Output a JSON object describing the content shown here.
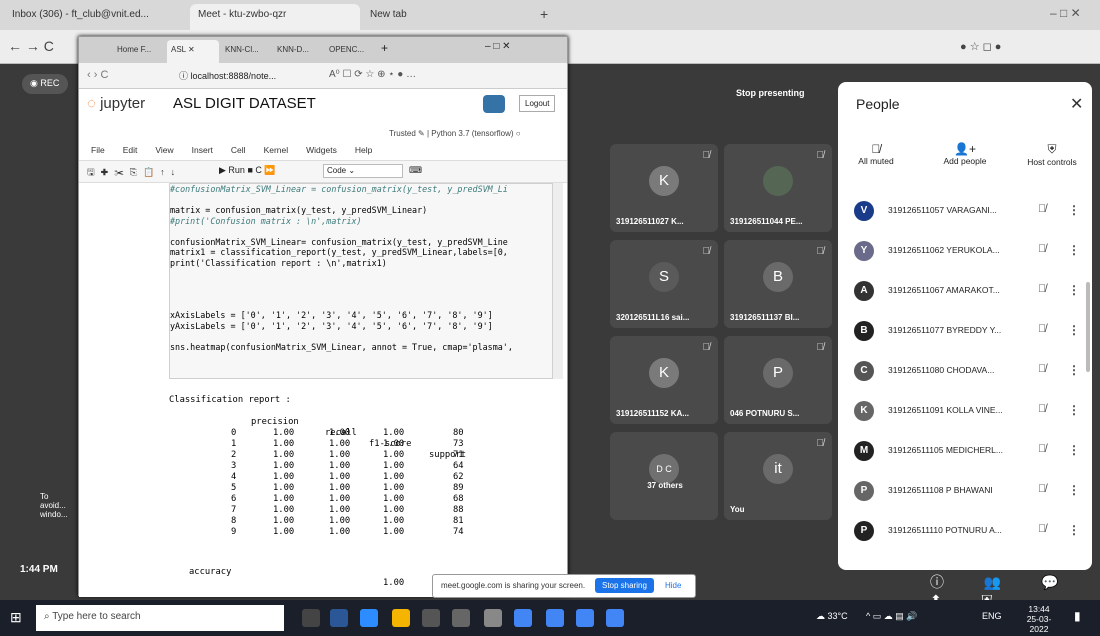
{
  "outer_tabs": [
    {
      "label": "Inbox (306) - ft_club@vnit.ed..."
    },
    {
      "label": "Meet - ktu-zwbo-qzr"
    },
    {
      "label": "New tab"
    }
  ],
  "meet": {
    "rec_label": "REC",
    "stop_presenting": "Stop presenting",
    "clock": "1:44 PM",
    "side_text": "To avoid... windo...",
    "tiles": [
      {
        "initial": "K",
        "name": "319126511027 K...",
        "color": "#7a7a7a"
      },
      {
        "initial": "",
        "name": "319126511044 PE...",
        "color": "#5a6a5a"
      },
      {
        "initial": "S",
        "name": "320126511L16 sai...",
        "color": "#5a5a5a"
      },
      {
        "initial": "B",
        "name": "319126511137 BI...",
        "color": "#6a6a6a"
      },
      {
        "initial": "K",
        "name": "319126511152 KA...",
        "color": "#7a7a7a"
      },
      {
        "initial": "P",
        "name": "046 POTNURU S...",
        "color": "#6a6a6a"
      },
      {
        "initial": "D C",
        "name": "37 others",
        "color": "#707070"
      },
      {
        "initial": "it",
        "name": "You",
        "color": "#6a6a6a"
      }
    ]
  },
  "inner_browser": {
    "tabs": [
      {
        "label": "Home F..."
      },
      {
        "label": "ASL"
      },
      {
        "label": "KNN-Cl..."
      },
      {
        "label": "KNN-D..."
      },
      {
        "label": "OPENC..."
      }
    ],
    "address": "localhost:8888/note...",
    "jupyter_logo": "jupyter",
    "notebook_title": "ASL DIGIT DATASET",
    "logout": "Logout",
    "trusted": "Trusted",
    "kernel": "Python 3.7 (tensorflow)",
    "menu": [
      "File",
      "Edit",
      "View",
      "Insert",
      "Cell",
      "Kernel",
      "Widgets",
      "Help"
    ],
    "run_label": "Run",
    "cell_type": "Code",
    "code_lines": [
      "#confusionMatrix_SVM_Linear = confusion_matrix(y_test, y_predSVM_Li",
      "",
      "matrix = confusion_matrix(y_test, y_predSVM_Linear)",
      "#print('Confusion matrix : \\n',matrix)",
      "",
      "confusionMatrix_SVM_Linear= confusion_matrix(y_test, y_predSVM_Line",
      "matrix1 = classification_report(y_test, y_predSVM_Linear,labels=[0,",
      "print('Classification report : \\n',matrix1)",
      "",
      "",
      "",
      "",
      "xAxisLabels = ['0', '1', '2', '3', '4', '5', '6', '7', '8', '9']",
      "yAxisLabels = ['0', '1', '2', '3', '4', '5', '6', '7', '8', '9']",
      "",
      "sns.heatmap(confusionMatrix_SVM_Linear, annot = True, cmap='plasma',"
    ],
    "report_title": "Classification report :",
    "report_headers": [
      "precision",
      "recall",
      "f1-score",
      "support"
    ],
    "report_rows": [
      {
        "label": "0",
        "precision": "1.00",
        "recall": "1.00",
        "f1": "1.00",
        "support": "80"
      },
      {
        "label": "1",
        "precision": "1.00",
        "recall": "1.00",
        "f1": "1.00",
        "support": "73"
      },
      {
        "label": "2",
        "precision": "1.00",
        "recall": "1.00",
        "f1": "1.00",
        "support": "71"
      },
      {
        "label": "3",
        "precision": "1.00",
        "recall": "1.00",
        "f1": "1.00",
        "support": "64"
      },
      {
        "label": "4",
        "precision": "1.00",
        "recall": "1.00",
        "f1": "1.00",
        "support": "62"
      },
      {
        "label": "5",
        "precision": "1.00",
        "recall": "1.00",
        "f1": "1.00",
        "support": "89"
      },
      {
        "label": "6",
        "precision": "1.00",
        "recall": "1.00",
        "f1": "1.00",
        "support": "68"
      },
      {
        "label": "7",
        "precision": "1.00",
        "recall": "1.00",
        "f1": "1.00",
        "support": "88"
      },
      {
        "label": "8",
        "precision": "1.00",
        "recall": "1.00",
        "f1": "1.00",
        "support": "81"
      },
      {
        "label": "9",
        "precision": "1.00",
        "recall": "1.00",
        "f1": "1.00",
        "support": "74"
      }
    ],
    "accuracy_label": "accuracy",
    "accuracy_value": "1.00"
  },
  "people_panel": {
    "title": "People",
    "actions": [
      "All muted",
      "Add people",
      "Host controls"
    ],
    "participants": [
      {
        "initial": "V",
        "name": "319126511057 VARAGANI...",
        "color": "#1a3a8a"
      },
      {
        "initial": "Y",
        "name": "319126511062 YERUKOLA...",
        "color": "#6a6a8a"
      },
      {
        "initial": "A",
        "name": "319126511067 AMARAKOT...",
        "color": "#333"
      },
      {
        "initial": "B",
        "name": "319126511077 BYREDDY Y...",
        "color": "#222"
      },
      {
        "initial": "C",
        "name": "319126511080 CHODAVA...",
        "color": "#555"
      },
      {
        "initial": "K",
        "name": "319126511091 KOLLA VINE...",
        "color": "#666"
      },
      {
        "initial": "M",
        "name": "319126511105 MEDICHERL...",
        "color": "#222"
      },
      {
        "initial": "P",
        "name": "319126511108 P BHAWANI",
        "color": "#666"
      },
      {
        "initial": "P",
        "name": "319126511110 POTNURU A...",
        "color": "#222"
      }
    ]
  },
  "share_bar": {
    "text": "meet.google.com is sharing your screen.",
    "stop": "Stop sharing",
    "hide": "Hide"
  },
  "taskbar": {
    "search_placeholder": "Type here to search",
    "weather": "33°C",
    "lang": "ENG",
    "time": "13:44",
    "date": "25-03-2022"
  }
}
